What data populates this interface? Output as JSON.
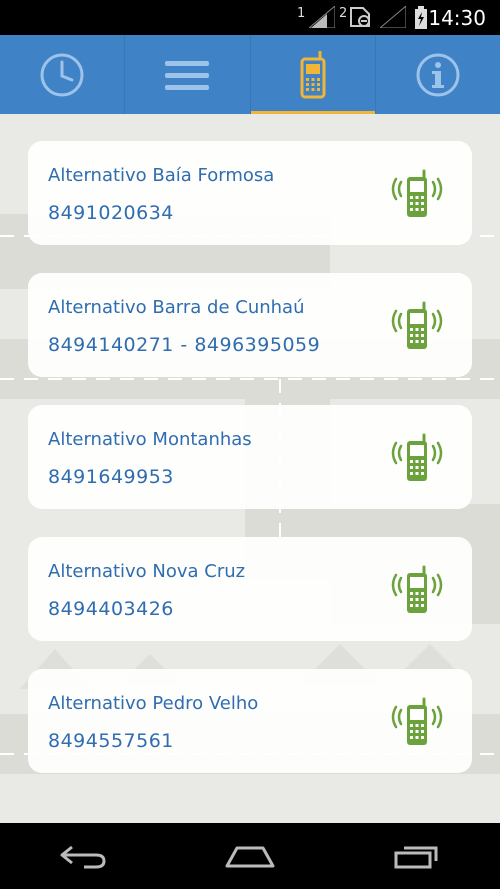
{
  "status_bar": {
    "sim1_label": "1",
    "sim2_label": "2",
    "time": "14:30"
  },
  "tabs": [
    {
      "icon": "clock-icon",
      "active": false
    },
    {
      "icon": "menu-icon",
      "active": false
    },
    {
      "icon": "mobile-phone-icon",
      "active": true
    },
    {
      "icon": "info-icon",
      "active": false
    }
  ],
  "contacts": [
    {
      "name": "Alternativo Baía Formosa",
      "phone": "8491020634"
    },
    {
      "name": "Alternativo Barra de Cunhaú",
      "phone": "8494140271 - 8496395059"
    },
    {
      "name": "Alternativo Montanhas",
      "phone": "8491649953"
    },
    {
      "name": "Alternativo Nova Cruz",
      "phone": "8494403426"
    },
    {
      "name": "Alternativo Pedro Velho",
      "phone": "8494557561"
    }
  ],
  "nav": [
    "back-icon",
    "home-icon",
    "recent-apps-icon"
  ],
  "colors": {
    "tab_bar": "#3f82c6",
    "tab_active_indicator": "#f1b537",
    "text_blue": "#2f6db0",
    "call_icon_green": "#6ba23c",
    "background": "#e9e9e5"
  }
}
